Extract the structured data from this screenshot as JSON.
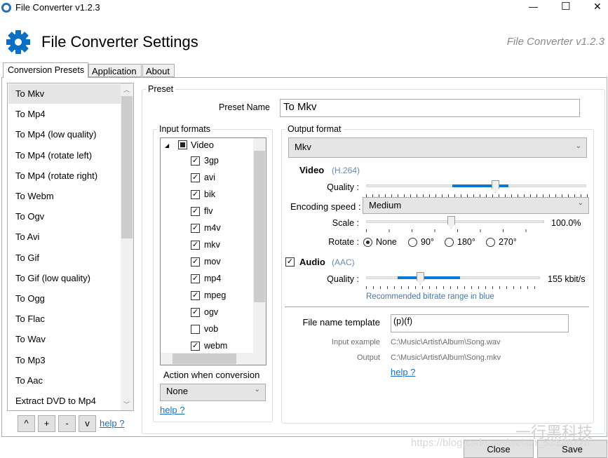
{
  "window": {
    "title": "File Converter v1.2.3",
    "controls": {
      "minimize": "—",
      "maximize": "☐",
      "close": "✕"
    }
  },
  "header": {
    "title": "File Converter Settings",
    "version": "File Converter v1.2.3",
    "accent": "#0a6ec4"
  },
  "tabs": [
    {
      "label": "Conversion Presets",
      "selected": true
    },
    {
      "label": "Application"
    },
    {
      "label": "About"
    }
  ],
  "presets": {
    "items": [
      "To Mkv",
      "To Mp4",
      "To Mp4 (low quality)",
      "To Mp4 (rotate left)",
      "To Mp4 (rotate right)",
      "To Webm",
      "To Ogv",
      "To Avi",
      "To Gif",
      "To Gif (low quality)",
      "To Ogg",
      "To Flac",
      "To Wav",
      "To Mp3",
      "To Aac",
      "Extract DVD to Mp4"
    ],
    "selected": "To Mkv",
    "buttons": {
      "up": "^",
      "add": "+",
      "remove": "-",
      "down": "v"
    },
    "help": "help ?"
  },
  "preset": {
    "group_label": "Preset",
    "name_label": "Preset Name",
    "name_value": "To Mkv"
  },
  "input_formats": {
    "label": "Input formats",
    "root": "Video",
    "items": [
      {
        "name": "3gp",
        "checked": true
      },
      {
        "name": "avi",
        "checked": true
      },
      {
        "name": "bik",
        "checked": true
      },
      {
        "name": "flv",
        "checked": true
      },
      {
        "name": "m4v",
        "checked": true
      },
      {
        "name": "mkv",
        "checked": true
      },
      {
        "name": "mov",
        "checked": true
      },
      {
        "name": "mp4",
        "checked": true
      },
      {
        "name": "mpeg",
        "checked": true
      },
      {
        "name": "ogv",
        "checked": true
      },
      {
        "name": "vob",
        "checked": false
      },
      {
        "name": "webm",
        "checked": true
      }
    ],
    "action_label": "Action when conversion",
    "action_value": "None",
    "help": "help ?"
  },
  "output": {
    "label": "Output format",
    "format": "Mkv",
    "video": {
      "label": "Video",
      "codec": "(H.264)",
      "quality_label": "Quality :",
      "encoding_label": "Encoding speed :",
      "encoding_value": "Medium",
      "scale_label": "Scale :",
      "scale_value": "100.0%",
      "rotate_label": "Rotate :",
      "rotate_options": [
        "None",
        "90°",
        "180°",
        "270°"
      ],
      "rotate_selected": "None"
    },
    "audio": {
      "enabled": true,
      "label": "Audio",
      "codec": "(AAC)",
      "quality_label": "Quality :",
      "quality_value": "155 kbit/s",
      "hint": "Recommended bitrate range in blue"
    },
    "template_label": "File name template",
    "template_value": "(p)(f)",
    "input_example_label": "Input example",
    "input_example": "C:\\Music\\Artist\\Album\\Song.wav",
    "output_label": "Output",
    "output_example": "C:\\Music\\Artist\\Album\\Song.mkv",
    "help": "help ?"
  },
  "footer": {
    "close": "Close",
    "save": "Save"
  },
  "watermark": {
    "brand": "一行黑科技",
    "url": "https://blog.csdn.net/weixin_53126778"
  }
}
